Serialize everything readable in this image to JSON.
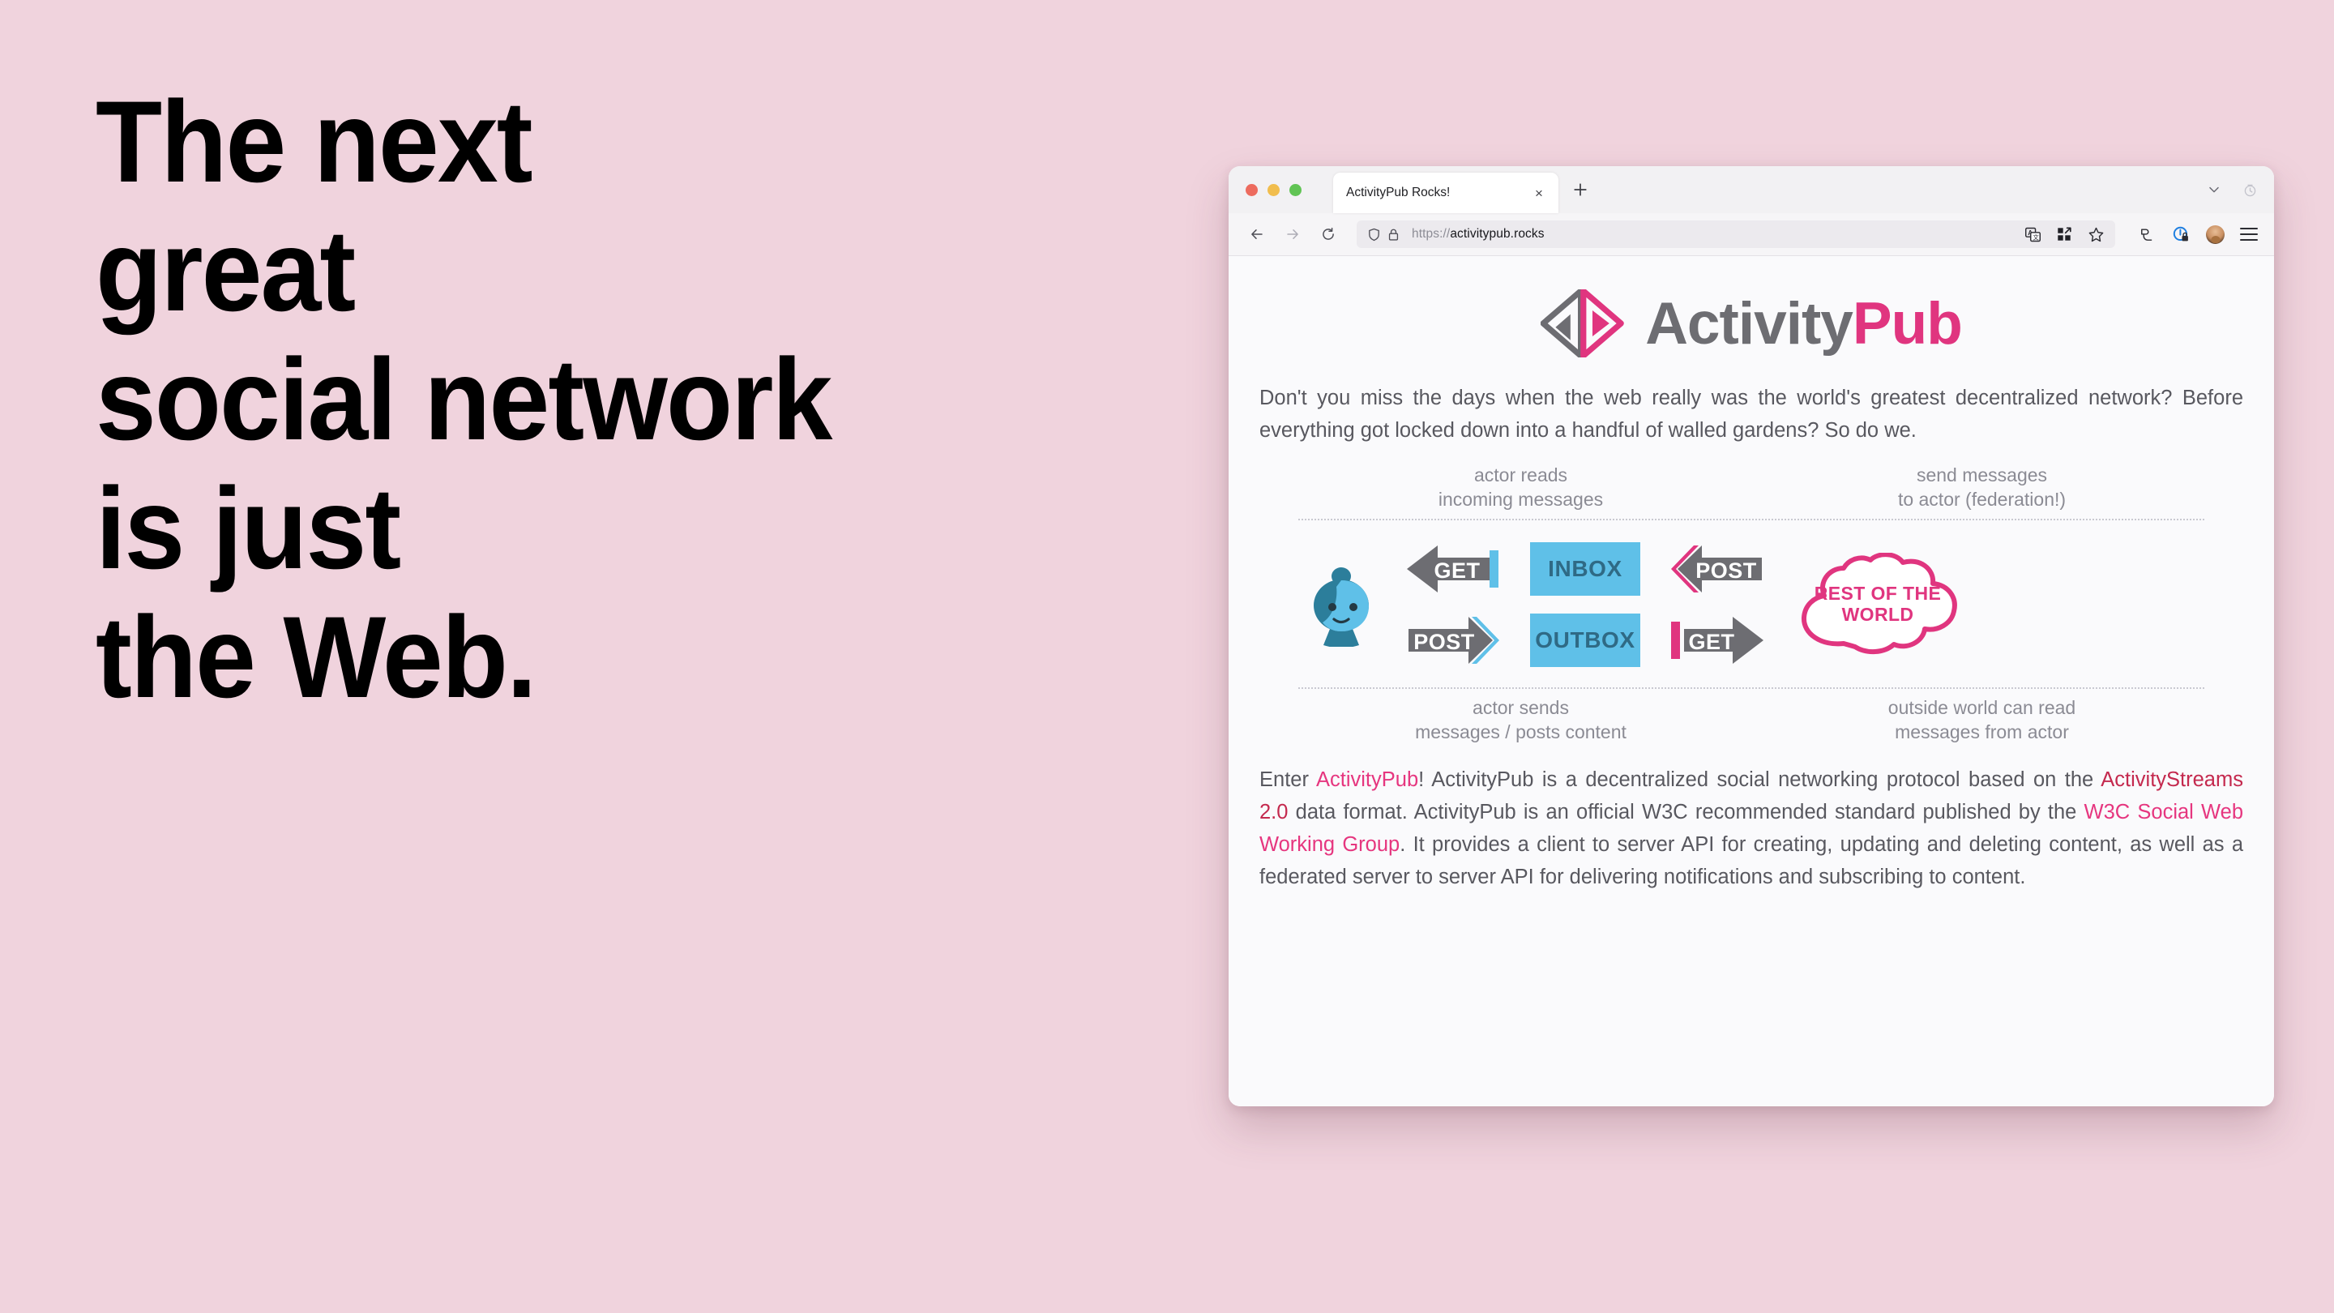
{
  "page": {
    "background_color": "#f0d3dd",
    "headline_lines": [
      "The next",
      "great",
      "social network",
      "is just",
      "the Web."
    ]
  },
  "browser": {
    "traffic_lights": [
      "close",
      "minimize",
      "zoom"
    ],
    "tab": {
      "title": "ActivityPub Rocks!",
      "close_label": "×"
    },
    "new_tab_label": "+",
    "tabstrip_right_icons": [
      "chevron-down-icon",
      "history-clock-icon"
    ],
    "nav_icons": [
      "back-arrow-icon",
      "forward-arrow-icon",
      "reload-icon"
    ],
    "url": {
      "scheme": "https://",
      "host": "activitypub.rocks",
      "shield_icon": "shield-icon",
      "lock_icon": "lock-icon"
    },
    "urlbar_action_icons": [
      "translate-icon",
      "extensions-grid-icon",
      "bookmark-star-icon"
    ],
    "toolbar_right_icons": [
      "share-icon",
      "privacy-shield-icon",
      "profile-avatar",
      "menu-icon"
    ]
  },
  "site": {
    "logo": {
      "word_1": "Activity",
      "word_2": "Pub",
      "gray": "#6d6d72",
      "pink": "#e0357f"
    },
    "intro_paragraph": "Don't you miss the days when the web really was the world's greatest decentralized network? Before everything got locked down into a handful of walled gardens? So do we.",
    "diagram": {
      "top_labels": [
        {
          "line1": "actor reads",
          "line2": "incoming messages"
        },
        {
          "line1": "send messages",
          "line2": "to actor (federation!)"
        }
      ],
      "bottom_labels": [
        {
          "line1": "actor sends",
          "line2": "messages / posts content"
        },
        {
          "line1": "outside world can read",
          "line2": "messages from actor"
        }
      ],
      "actor_icon": "actor-person-icon",
      "arrows": [
        {
          "id": "get-left",
          "label": "GET",
          "direction": "left",
          "accent": "#5fc0e8"
        },
        {
          "id": "post-left",
          "label": "POST",
          "direction": "left",
          "accent": "#e6367f"
        },
        {
          "id": "post-right",
          "label": "POST",
          "direction": "right",
          "accent": "#5fc0e8"
        },
        {
          "id": "get-right",
          "label": "GET",
          "direction": "right",
          "accent": "#e6367f"
        }
      ],
      "boxes": [
        {
          "id": "inbox",
          "label": "INBOX"
        },
        {
          "id": "outbox",
          "label": "OUTBOX"
        }
      ],
      "cloud": {
        "line1": "REST OF THE",
        "line2": "WORLD",
        "color": "#e0357f"
      },
      "box_fill": "#5fc0e8",
      "box_text_color": "#2f6a85",
      "arrow_body_color": "#6d6d72"
    },
    "outro": {
      "t1": "Enter ",
      "link1": "ActivityPub",
      "t2": "! ActivityPub is a decentralized social networking protocol based on the ",
      "link2": "ActivityStreams 2.0",
      "t3": " data format. ActivityPub is an official W3C recommended standard published by the ",
      "link3": "W3C Social Web Working Group",
      "t4": ". It provides a client to server API for creating, updating and deleting content, as well as a federated server to server API for delivering notifications and subscribing to content."
    }
  }
}
